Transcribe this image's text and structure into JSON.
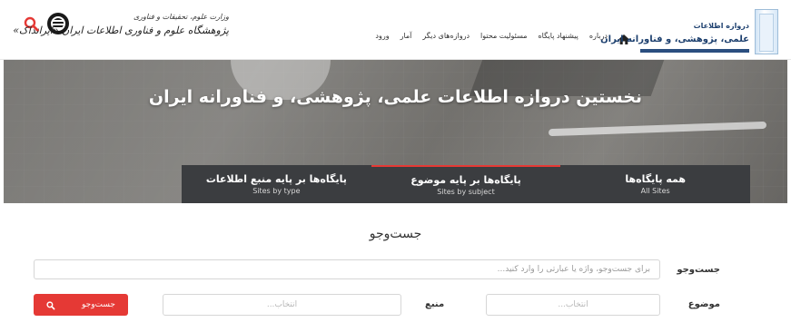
{
  "header": {
    "institute": {
      "ministry_line": "وزارت علوم، تحقیقات و فناوری",
      "name_line": "پژوهشگاه علوم و فناوری اطلاعات ایران «ایرانداک»"
    },
    "nav": [
      "درباره",
      "پیشنهاد پایگاه",
      "مسئولیت محتوا",
      "دروازه‌های دیگر",
      "آمار",
      "ورود"
    ],
    "site_logo": {
      "line1": "دروازه اطلاعات",
      "line2": "علمی، پژوهشی، و فناورانه ایران"
    }
  },
  "hero": {
    "title": "نخستین دروازه اطلاعات علمی، پژوهشی، و فناورانه ایران",
    "tabs": [
      {
        "fa": "پایگاه‌ها بر پایه منبع اطلاعات",
        "en": "Sites by type"
      },
      {
        "fa": "پایگاه‌ها بر پایه موضوع",
        "en": "Sites by subject"
      },
      {
        "fa": "همه پایگاه‌ها",
        "en": "All Sites"
      }
    ]
  },
  "search": {
    "title": "جست‌وجو",
    "query_label": "جست‌وجو",
    "query_placeholder": "برای جست‌وجو، واژه یا عبارتی را وارد کنید...",
    "subject_label": "موضوع",
    "subject_placeholder": "انتخاب...",
    "source_label": "منبع",
    "source_placeholder": "انتخاب...",
    "submit_label": "جست‌وجو"
  },
  "colors": {
    "accent": "#e53935",
    "tabs_bg": "#3b3d40",
    "brand_blue": "#1c3f6e"
  },
  "icons": {
    "search": "search-icon",
    "home": "home-icon",
    "ministry_logo": "ministry-logo-icon"
  }
}
